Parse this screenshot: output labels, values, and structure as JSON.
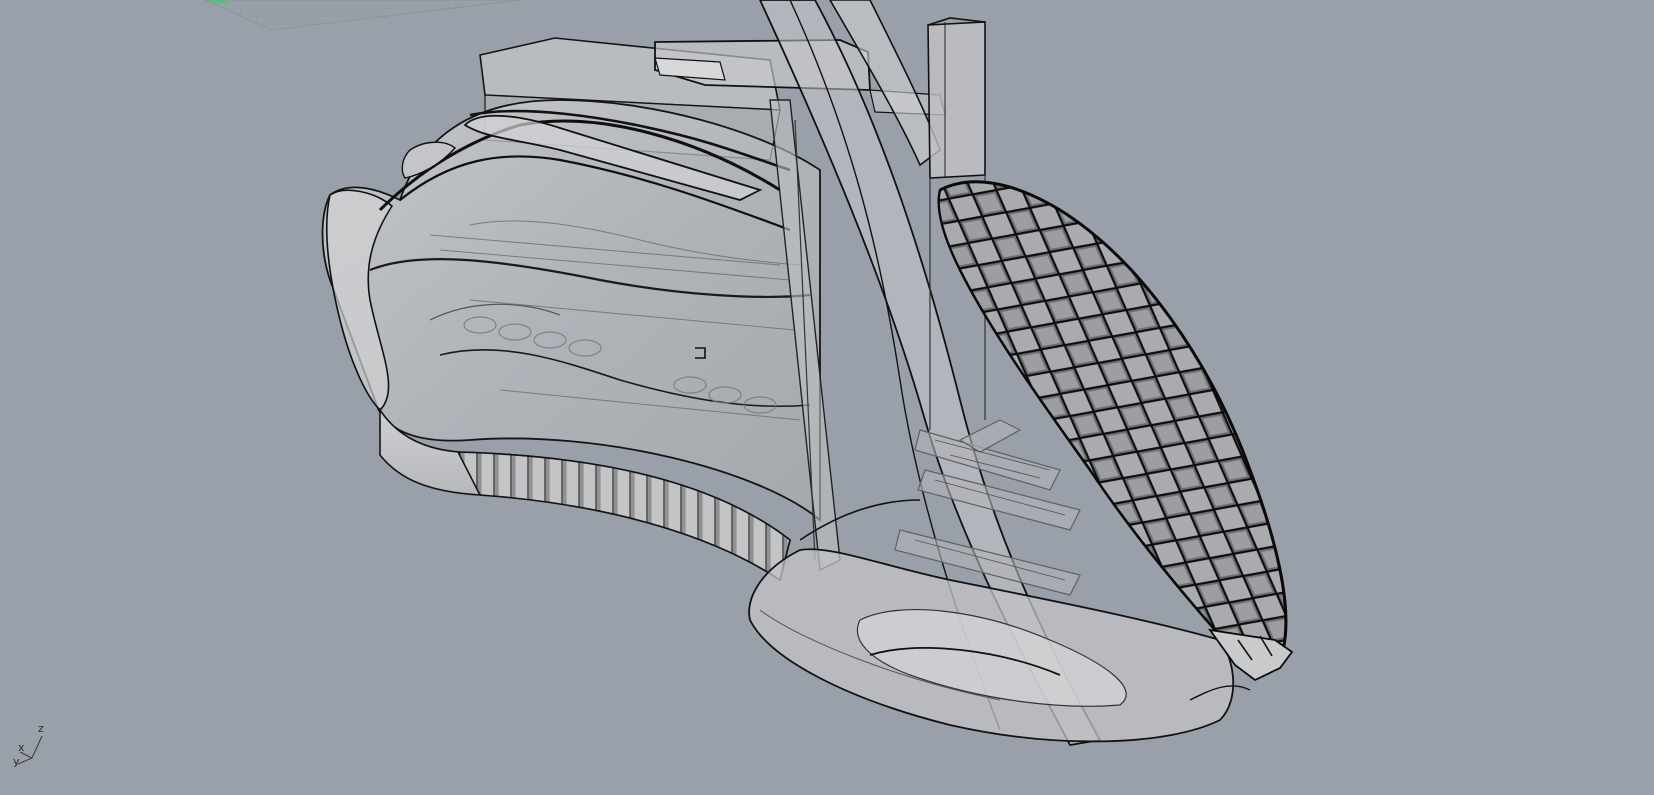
{
  "viewport": {
    "background": "#9aa0aa",
    "display_mode": "x-ray",
    "model_fill": "#b8babd",
    "edge_color": "#111111",
    "grid_accent": "#3dd06a"
  },
  "axis_widget": {
    "z_label": "z",
    "x_label": "x",
    "y_label": "y"
  }
}
